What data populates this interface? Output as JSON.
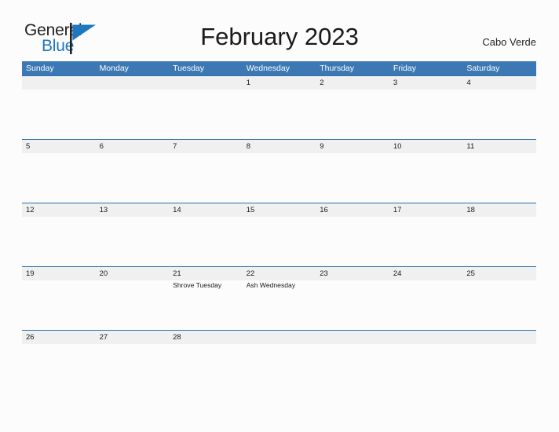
{
  "logo": {
    "word_one": "General",
    "word_two": "Blue",
    "flag_icon": "blue-flag-icon",
    "dark_color": "#231f20",
    "blue_color": "#1f77bf"
  },
  "header": {
    "title": "February 2023",
    "locale": "Cabo Verde"
  },
  "theme": {
    "header_blue": "#3c78b4",
    "rule_blue": "#2f6fae",
    "band_gray": "#f0f0f0",
    "page_background": "#fcfcfc",
    "text_color": "#1a1a1a"
  },
  "calendar": {
    "month": "February",
    "year": "2023",
    "day_headers": [
      "Sunday",
      "Monday",
      "Tuesday",
      "Wednesday",
      "Thursday",
      "Friday",
      "Saturday"
    ],
    "weeks": [
      [
        {
          "date": "",
          "events": []
        },
        {
          "date": "",
          "events": []
        },
        {
          "date": "",
          "events": []
        },
        {
          "date": "1",
          "events": []
        },
        {
          "date": "2",
          "events": []
        },
        {
          "date": "3",
          "events": []
        },
        {
          "date": "4",
          "events": []
        }
      ],
      [
        {
          "date": "5",
          "events": []
        },
        {
          "date": "6",
          "events": []
        },
        {
          "date": "7",
          "events": []
        },
        {
          "date": "8",
          "events": []
        },
        {
          "date": "9",
          "events": []
        },
        {
          "date": "10",
          "events": []
        },
        {
          "date": "11",
          "events": []
        }
      ],
      [
        {
          "date": "12",
          "events": []
        },
        {
          "date": "13",
          "events": []
        },
        {
          "date": "14",
          "events": []
        },
        {
          "date": "15",
          "events": []
        },
        {
          "date": "16",
          "events": []
        },
        {
          "date": "17",
          "events": []
        },
        {
          "date": "18",
          "events": []
        }
      ],
      [
        {
          "date": "19",
          "events": []
        },
        {
          "date": "20",
          "events": []
        },
        {
          "date": "21",
          "events": [
            "Shrove Tuesday"
          ]
        },
        {
          "date": "22",
          "events": [
            "Ash Wednesday"
          ]
        },
        {
          "date": "23",
          "events": []
        },
        {
          "date": "24",
          "events": []
        },
        {
          "date": "25",
          "events": []
        }
      ],
      [
        {
          "date": "26",
          "events": []
        },
        {
          "date": "27",
          "events": []
        },
        {
          "date": "28",
          "events": []
        },
        {
          "date": "",
          "events": []
        },
        {
          "date": "",
          "events": []
        },
        {
          "date": "",
          "events": []
        },
        {
          "date": "",
          "events": []
        }
      ]
    ]
  }
}
